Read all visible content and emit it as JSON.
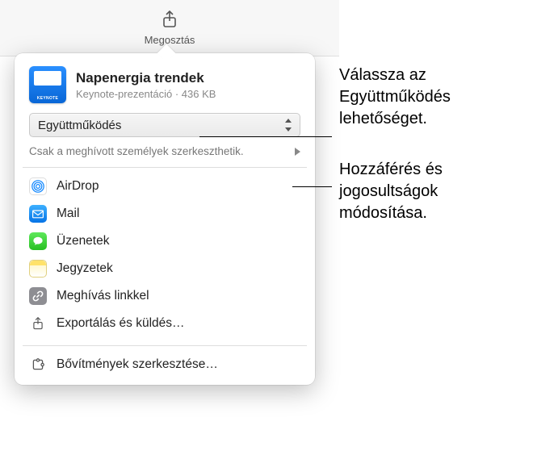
{
  "toolbar": {
    "share_label": "Megosztás"
  },
  "document": {
    "title": "Napenergia trendek",
    "meta": "Keynote-prezentáció · 436 KB"
  },
  "mode": {
    "selected": "Együttműködés"
  },
  "access": {
    "text": "Csak a meghívott személyek szerkeszthetik."
  },
  "share_options": [
    {
      "icon": "airdrop-icon",
      "label": "AirDrop"
    },
    {
      "icon": "mail-icon",
      "label": "Mail"
    },
    {
      "icon": "messages-icon",
      "label": "Üzenetek"
    },
    {
      "icon": "notes-icon",
      "label": "Jegyzetek"
    },
    {
      "icon": "link-icon",
      "label": "Meghívás linkkel"
    },
    {
      "icon": "export-icon",
      "label": "Exportálás és küldés…"
    }
  ],
  "extensions": {
    "label": "Bővítmények szerkesztése…"
  },
  "annotations": {
    "a1": "Válassza az Együttműködés lehetőséget.",
    "a2": "Hozzáférés és jogosultságok módosítása."
  }
}
